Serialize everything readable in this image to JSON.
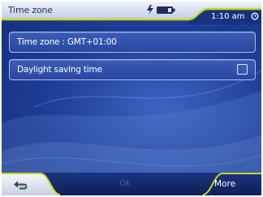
{
  "header": {
    "title": "Time zone",
    "clock": "1:10 am",
    "icons": [
      "power-plug-icon",
      "battery-icon",
      "alarm-clock-icon"
    ]
  },
  "settings": {
    "items": [
      {
        "label": "Time zone : GMT+01:00"
      },
      {
        "label": "Daylight saving time",
        "checked": false
      }
    ]
  },
  "footer": {
    "back_icon": "back-arrow-icon",
    "ok_label": "Ok",
    "ok_enabled": false,
    "more_label": "More"
  },
  "colors": {
    "background": "#1e3f98",
    "accent": "#c8d81e",
    "title_bar": "#d3dbea",
    "row_border": "#d2e1ff"
  }
}
